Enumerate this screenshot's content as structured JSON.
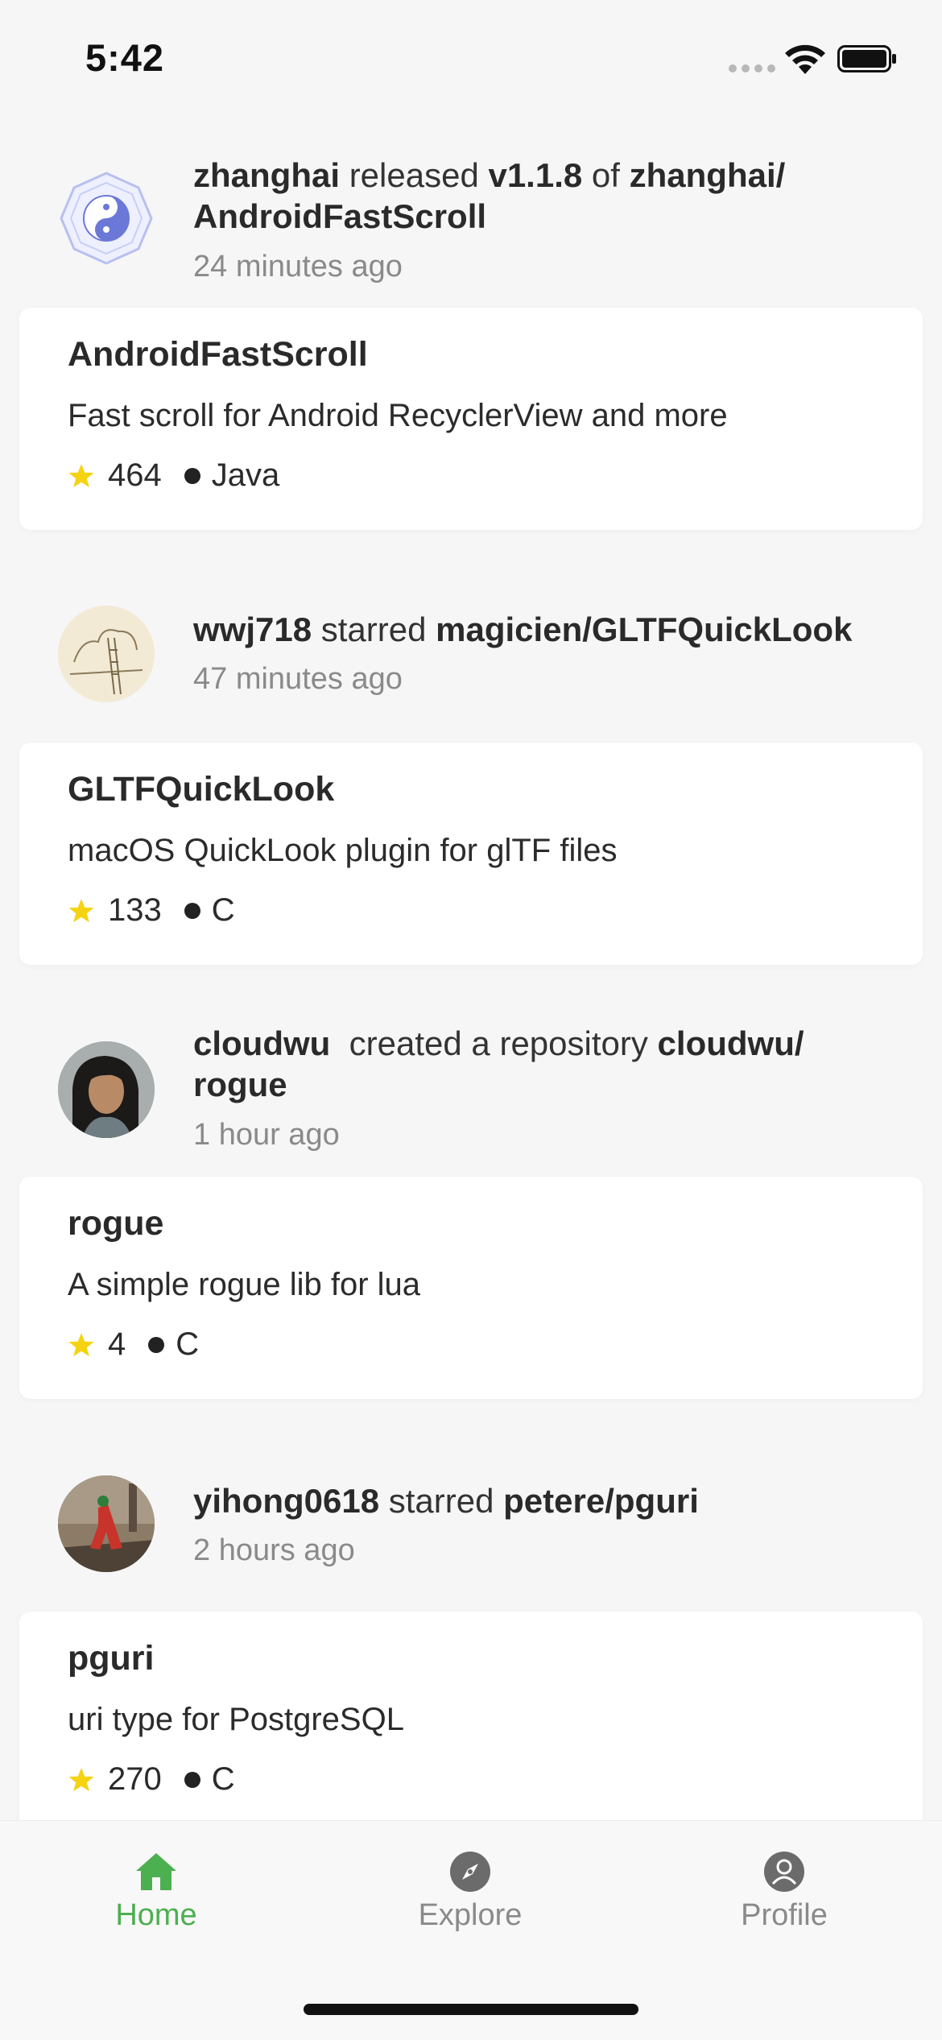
{
  "status_bar": {
    "time": "5:42"
  },
  "colors": {
    "accent_green": "#4caf50",
    "star_yellow": "#f5d313",
    "inactive_gray": "#8a8a8a"
  },
  "feed": [
    {
      "actor": "zhanghai",
      "action": "released",
      "version": "v1.1.8",
      "of_word": "of",
      "target": "zhanghai/ AndroidFastScroll",
      "time": "24 minutes ago",
      "avatar_icon": "yin-yang-avatar",
      "repo": {
        "name": "AndroidFastScroll",
        "description": "Fast scroll for Android RecyclerView and more",
        "stars": "464",
        "language": "Java"
      }
    },
    {
      "actor": "wwj718",
      "action": "starred",
      "target": "magicien/GLTFQuickLook",
      "time": "47 minutes ago",
      "avatar_icon": "sketch-avatar",
      "repo": {
        "name": "GLTFQuickLook",
        "description": "macOS QuickLook plugin for glTF files",
        "stars": "133",
        "language": "C"
      }
    },
    {
      "actor": "cloudwu",
      "action": "created a repository",
      "target": "cloudwu/ rogue",
      "time": "1 hour ago",
      "avatar_icon": "person-photo-avatar",
      "repo": {
        "name": "rogue",
        "description": "A simple rogue lib for lua",
        "stars": "4",
        "language": "C"
      }
    },
    {
      "actor": "yihong0618",
      "action": "starred",
      "target": "petere/pguri",
      "time": "2 hours ago",
      "avatar_icon": "photo-avatar",
      "repo": {
        "name": "pguri",
        "description": "uri type for PostgreSQL",
        "stars": "270",
        "language": "C"
      }
    }
  ],
  "tabs": [
    {
      "label": "Home",
      "icon": "home-icon",
      "active": true
    },
    {
      "label": "Explore",
      "icon": "compass-icon",
      "active": false
    },
    {
      "label": "Profile",
      "icon": "person-icon",
      "active": false
    }
  ]
}
